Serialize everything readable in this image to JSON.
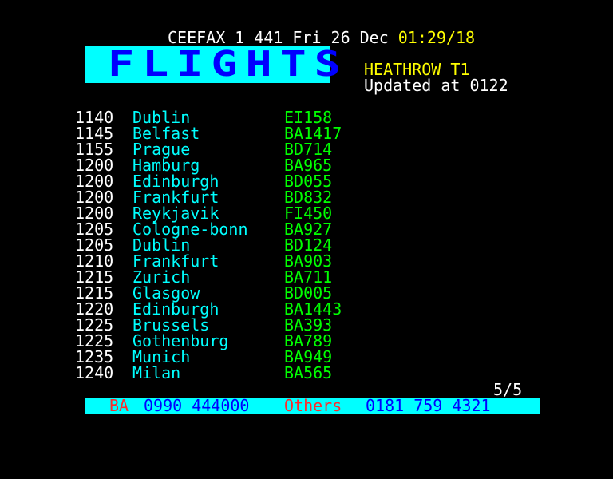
{
  "header": {
    "service": "CEEFAX",
    "channel": "1",
    "page": "441",
    "day": "Fri",
    "date": "26",
    "month": "Dec",
    "time": "01:29/18"
  },
  "banner": {
    "title": "FLIGHTS"
  },
  "location": "HEATHROW T1",
  "updated": "Updated at 0122",
  "flights": [
    {
      "time": "1140",
      "destination": "Dublin",
      "flight": "EI158"
    },
    {
      "time": "1145",
      "destination": "Belfast",
      "flight": "BA1417"
    },
    {
      "time": "1155",
      "destination": "Prague",
      "flight": "BD714"
    },
    {
      "time": "1200",
      "destination": "Hamburg",
      "flight": "BA965"
    },
    {
      "time": "1200",
      "destination": "Edinburgh",
      "flight": "BD055"
    },
    {
      "time": "1200",
      "destination": "Frankfurt",
      "flight": "BD832"
    },
    {
      "time": "1200",
      "destination": "Reykjavik",
      "flight": "FI450"
    },
    {
      "time": "1205",
      "destination": "Cologne-bonn",
      "flight": "BA927"
    },
    {
      "time": "1205",
      "destination": "Dublin",
      "flight": "BD124"
    },
    {
      "time": "1210",
      "destination": "Frankfurt",
      "flight": "BA903"
    },
    {
      "time": "1215",
      "destination": "Zurich",
      "flight": "BA711"
    },
    {
      "time": "1215",
      "destination": "Glasgow",
      "flight": "BD005"
    },
    {
      "time": "1220",
      "destination": "Edinburgh",
      "flight": "BA1443"
    },
    {
      "time": "1225",
      "destination": "Brussels",
      "flight": "BA393"
    },
    {
      "time": "1225",
      "destination": "Gothenburg",
      "flight": "BA789"
    },
    {
      "time": "1235",
      "destination": "Munich",
      "flight": "BA949"
    },
    {
      "time": "1240",
      "destination": "Milan",
      "flight": "BA565"
    }
  ],
  "pagination": "5/5",
  "phone_bar": {
    "ba_label": "BA",
    "ba_number": "0990 444000",
    "others_label": "Others",
    "others_number": "0181 759 4321"
  },
  "colors": {
    "background": "#000000",
    "banner_bg": "#00ffff",
    "banner_text": "#0000ff",
    "destination": "#00ffff",
    "flight_number": "#00ff00",
    "clock": "#ffff00",
    "phone_label": "#ff2a2a",
    "phone_number": "#0000ff"
  }
}
